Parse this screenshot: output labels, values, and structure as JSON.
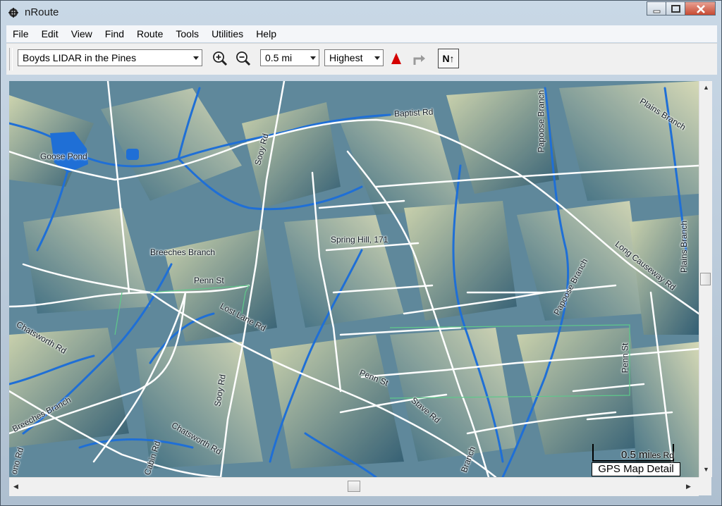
{
  "window": {
    "title": "nRoute"
  },
  "menu": [
    "File",
    "Edit",
    "View",
    "Find",
    "Route",
    "Tools",
    "Utilities",
    "Help"
  ],
  "toolbar": {
    "map_select": "Boyds LIDAR in the Pines",
    "scale_select": "0.5 mi",
    "detail_select": "Highest",
    "north_label": "N↑",
    "icons": [
      "zoom-in-icon",
      "zoom-out-icon",
      "position-arrow-icon",
      "turn-arrow-icon",
      "north-up-icon"
    ],
    "position_color": "#d40000"
  },
  "map": {
    "labels": {
      "goose_pond": "Goose Pond",
      "baptist_rd": "Baptist Rd",
      "sooy_rd_north": "Sooy Rd",
      "papoose_branch_north": "Papoose Branch",
      "plains_branch_top": "Plains Branch",
      "plains_branch_right": "Plains Branch",
      "breeches_branch": "Breeches Branch",
      "spring_hill": "Spring Hill, 171",
      "penn_st_west": "Penn St",
      "lost_lane_rd": "Lost Lane Rd",
      "long_causeway_rd": "Long Causeway Rd",
      "papoose_branch_south": "Papoose Branch",
      "chatsworth_rd_west": "Chatsworth Rd",
      "penn_st_east": "Penn St",
      "penn_st_center": "Penn St",
      "sooy_rd_south": "Sooy Rd",
      "stave_rd": "Stave Rd",
      "breeches_branch_south": "Breeches Branch",
      "chatsworth_rd_south": "Chatsworth Rd",
      "cabin_rd": "Cabin Rd",
      "ono_rd": "ono Rd",
      "branch_south": "Branch"
    },
    "scale_label": "0.5 mi",
    "scale_suffix": "les Rd",
    "detail_label": "GPS Map Detail",
    "colors": {
      "water": "#1f6fd6",
      "road": "#ffffff",
      "trail": "#5ec98a"
    }
  }
}
